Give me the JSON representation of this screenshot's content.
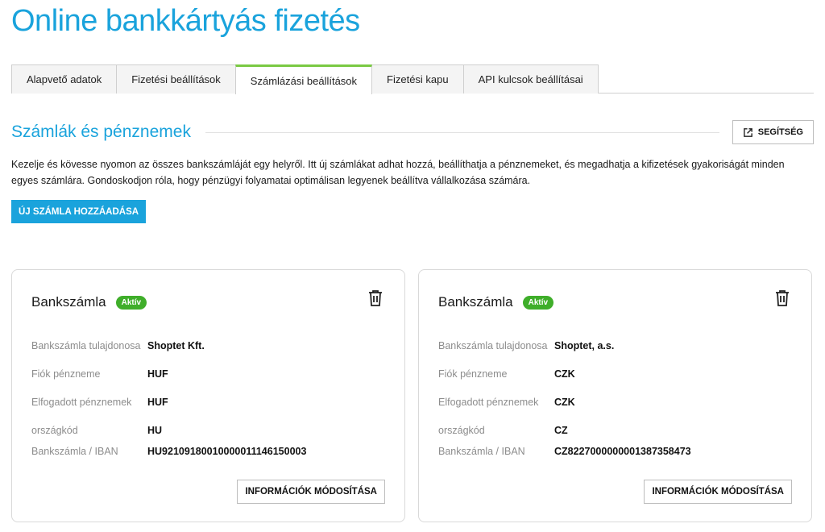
{
  "page": {
    "title": "Online bankkártyás fizetés"
  },
  "tabs": [
    {
      "label": "Alapvető adatok"
    },
    {
      "label": "Fizetési beállítások"
    },
    {
      "label": "Számlázási beállítások"
    },
    {
      "label": "Fizetési kapu"
    },
    {
      "label": "API kulcsok beállításai"
    }
  ],
  "section": {
    "title": "Számlák és pénznemek",
    "help_label": "SEGÍTSÉG",
    "description": "Kezelje és kövesse nyomon az összes bankszámláját egy helyről. Itt új számlákat adhat hozzá, beállíthatja a pénznemeket, és megadhatja a kifizetések gyakoriságát minden egyes számlára. Gondoskodjon róla, hogy pénzügyi folyamatai optimálisan legyenek beállítva vállalkozása számára.",
    "add_button": "ÚJ SZÁMLA HOZZÁADÁSA"
  },
  "labels": {
    "owner": "Bankszámla tulajdonosa",
    "account_currency": "Fiók pénzneme",
    "accepted_currencies": "Elfogadott pénznemek",
    "country_code": "országkód",
    "iban": "Bankszámla / IBAN",
    "edit_button": "INFORMÁCIÓK MÓDOSÍTÁSA"
  },
  "accounts": [
    {
      "title": "Bankszámla",
      "status": "Aktív",
      "owner": "Shoptet Kft.",
      "account_currency": "HUF",
      "accepted_currencies": "HUF",
      "country_code": "HU",
      "iban": "HU92109180010000011146150003"
    },
    {
      "title": "Bankszámla",
      "status": "Aktív",
      "owner": "Shoptet, a.s.",
      "account_currency": "CZK",
      "accepted_currencies": "CZK",
      "country_code": "CZ",
      "iban": "CZ8227000000001387358473"
    }
  ],
  "colors": {
    "accent": "#1aa3dc",
    "active_tab": "#7ac943",
    "badge": "#3fae2a"
  }
}
